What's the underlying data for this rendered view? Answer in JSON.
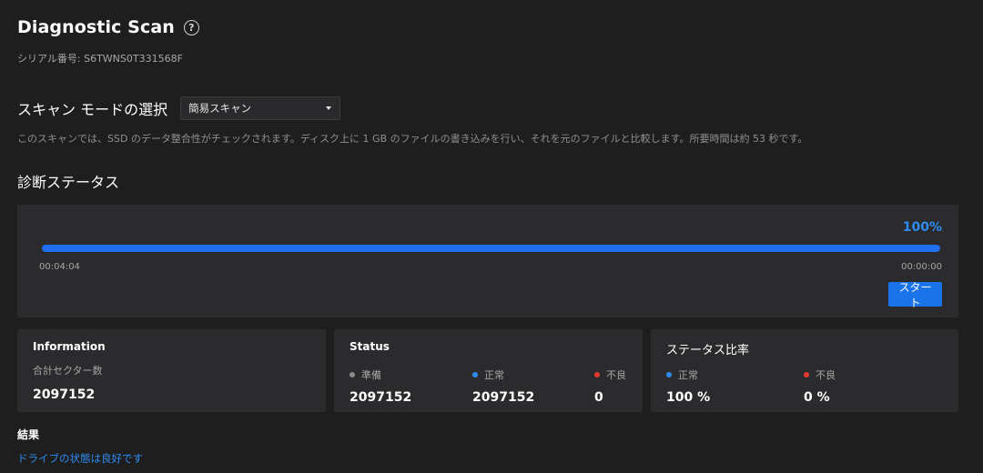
{
  "header": {
    "title": "Diagnostic Scan",
    "help_icon": "?",
    "serial": "シリアル番号: S6TWNS0T331568F"
  },
  "scan_mode": {
    "label": "スキャン モードの選択",
    "selected": "簡易スキャン",
    "description": "このスキャンでは、SSD のデータ整合性がチェックされます。ディスク上に 1 GB のファイルの書き込みを行い、それを元のファイルと比較します。所要時間は約 53 秒です。"
  },
  "diagnostic_status": {
    "title": "診断ステータス",
    "percent_text": "100%",
    "progress": 1.0,
    "elapsed": "00:04:04",
    "remaining": "00:00:00",
    "start_label": "スタート"
  },
  "information": {
    "title": "Information",
    "total_sectors_label": "合計セクター数",
    "total_sectors_value": "2097152"
  },
  "status": {
    "title": "Status",
    "items": [
      {
        "label": "準備",
        "value": "2097152",
        "color": "#8c8c8c"
      },
      {
        "label": "正常",
        "value": "2097152",
        "color": "#2d8cf0"
      },
      {
        "label": "不良",
        "value": "0",
        "color": "#e5392f"
      }
    ]
  },
  "ratio": {
    "title": "ステータス比率",
    "items": [
      {
        "label": "正常",
        "value": "100 %",
        "color": "#2d8cf0"
      },
      {
        "label": "不良",
        "value": "0 %",
        "color": "#e5392f"
      }
    ]
  },
  "result": {
    "title": "結果",
    "message": "ドライブの状態は良好です"
  },
  "colors": {
    "accent": "#1a73e8",
    "background": "#1e1e1f",
    "panel": "#2b2b2d"
  }
}
